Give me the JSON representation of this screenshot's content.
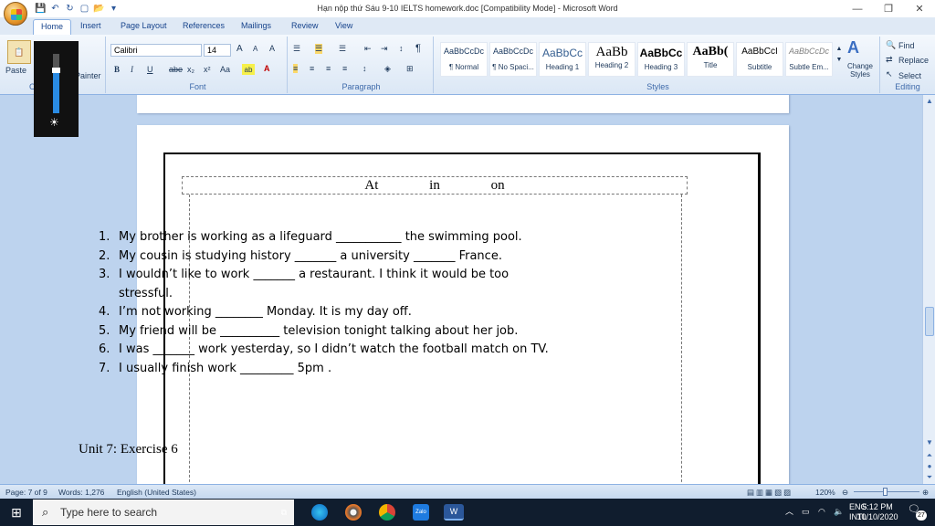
{
  "window": {
    "title": "Hạn nộp thứ Sáu 9-10 IELTS homework.doc [Compatibility Mode] - Microsoft Word",
    "controls": [
      "—",
      "❐",
      "✕"
    ]
  },
  "tabs": [
    {
      "label": "Home",
      "active": true
    },
    {
      "label": "Insert"
    },
    {
      "label": "Page Layout"
    },
    {
      "label": "References"
    },
    {
      "label": "Mailings"
    },
    {
      "label": "Review"
    },
    {
      "label": "View"
    }
  ],
  "ribbon": {
    "clipboard": {
      "paste": "Paste",
      "format_painter": "Painter"
    },
    "font": {
      "label": "Font",
      "name": "Calibri",
      "size": "14",
      "bold": "B",
      "italic": "I",
      "underline": "U",
      "strike": "abe",
      "subscript": "x₂",
      "superscript": "x²",
      "change_case": "Aa",
      "grow": "A",
      "shrink": "A",
      "clear": "A"
    },
    "paragraph": {
      "label": "Paragraph"
    },
    "styles": {
      "label": "Styles",
      "items": [
        {
          "sample": "AaBbCcDc",
          "name": "¶ Normal"
        },
        {
          "sample": "AaBbCcDc",
          "name": "¶ No Spaci..."
        },
        {
          "sample": "AaBbCc",
          "name": "Heading 1"
        },
        {
          "sample": "AaBb",
          "name": "Heading 2"
        },
        {
          "sample": "AaBbCc",
          "name": "Heading 3"
        },
        {
          "sample": "AaBb(",
          "name": "Title"
        },
        {
          "sample": "AaBbCcI",
          "name": "Subtitle"
        },
        {
          "sample": "AaBbCcDc",
          "name": "Subtle Em..."
        }
      ],
      "change_styles": "Change Styles"
    },
    "editing": {
      "label": "Editing",
      "find": "Find",
      "replace": "Replace",
      "select": "Select"
    }
  },
  "brightness": {
    "level": 0.68
  },
  "document": {
    "word_box": [
      "At",
      "in",
      "on"
    ],
    "exercise": [
      {
        "num": "1.",
        "text": "My brother is working as a lifeguard ___________  the swimming pool."
      },
      {
        "num": "2.",
        "text": "My cousin is studying history _______  a university _______  France."
      },
      {
        "num": "3.",
        "text": "I wouldn’t like to work _______ a restaurant. I think it would be too stressful."
      },
      {
        "num": "4.",
        "text": "I’m not working ________ Monday. It is my day off."
      },
      {
        "num": "5.",
        "text": "My friend will be __________  television tonight talking about her job."
      },
      {
        "num": "6.",
        "text": "I was _______  work yesterday, so I didn’t watch the football match on TV."
      },
      {
        "num": "7.",
        "text": "I usually finish work  _________ 5pm ."
      }
    ],
    "next_heading": "Unit 7: Exercise 6"
  },
  "status": {
    "page": "Page: 7 of 9",
    "words": "Words: 1,276",
    "language": "English (United States)",
    "zoom": "120%"
  },
  "taskbar": {
    "search_placeholder": "Type here to search",
    "lang_top": "ENG",
    "lang_bottom": "INTL",
    "time": "5:12 PM",
    "date": "10/10/2020",
    "notifications": "27"
  }
}
